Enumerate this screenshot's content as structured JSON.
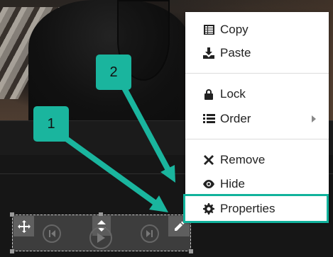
{
  "menu": {
    "items": [
      {
        "label": "Copy",
        "icon": "copy-icon"
      },
      {
        "label": "Paste",
        "icon": "paste-icon"
      },
      {
        "label": "Lock",
        "icon": "lock-icon"
      },
      {
        "label": "Order",
        "icon": "order-icon",
        "submenu": true
      },
      {
        "label": "Remove",
        "icon": "remove-icon"
      },
      {
        "label": "Hide",
        "icon": "eye-icon"
      },
      {
        "label": "Properties",
        "icon": "gear-icon",
        "highlighted": true
      }
    ]
  },
  "callouts": [
    {
      "number": "1"
    },
    {
      "number": "2"
    }
  ],
  "colors": {
    "accent": "#1ab59e",
    "menu_bg": "#ffffff",
    "player_bg": "#3d3d3d"
  }
}
